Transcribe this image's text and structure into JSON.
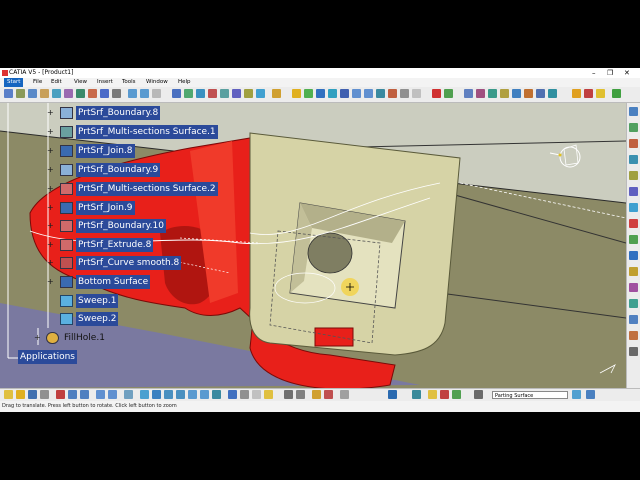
{
  "window": {
    "title": "CATIA V5 - [Product1]",
    "minimize": "–",
    "maximize": "❐",
    "close": "✕"
  },
  "menu": [
    "Start",
    "File",
    "Edit",
    "View",
    "Insert",
    "Tools",
    "Window",
    "Help"
  ],
  "tree": {
    "items": [
      {
        "label": "PrtSrf_Boundary.8",
        "icon": "boundary-icon"
      },
      {
        "label": "PrtSrf_Multi-sections Surface.1",
        "icon": "multi-sections-surface-icon"
      },
      {
        "label": "PrtSrf_Join.8",
        "icon": "join-icon"
      },
      {
        "label": "PrtSrf_Boundary.9",
        "icon": "boundary-icon"
      },
      {
        "label": "PrtSrf_Multi-sections Surface.2",
        "icon": "multi-sections-surface-icon"
      },
      {
        "label": "PrtSrf_Join.9",
        "icon": "join-icon"
      },
      {
        "label": "PrtSrf_Boundary.10",
        "icon": "boundary-icon"
      },
      {
        "label": "PrtSrf_Extrude.8",
        "icon": "extrude-icon"
      },
      {
        "label": "PrtSrf_Curve smooth.8",
        "icon": "curve-smooth-icon"
      },
      {
        "label": "Bottom Surface",
        "icon": "surface-icon"
      },
      {
        "label": "Sweep.1",
        "icon": "sweep-icon"
      },
      {
        "label": "Sweep.2",
        "icon": "sweep-icon"
      }
    ],
    "fillhole": "FillHole.1",
    "applications": "Applications"
  },
  "bottom_toolbar": {
    "parting_surface": "Parting Surface"
  },
  "status": {
    "message": "Drag to translate. Press left button to rotate. Click left button to zoom"
  },
  "colors": {
    "selection": "#2b4a9a",
    "model_red": "#e8201a",
    "model_beige": "#d6d3a6"
  }
}
